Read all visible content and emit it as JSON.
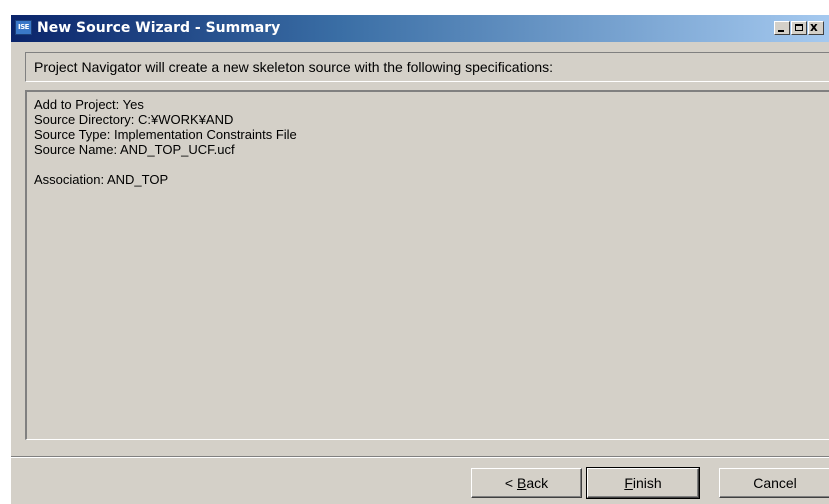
{
  "window": {
    "title": "New Source Wizard - Summary",
    "app_icon_text": "ISE",
    "controls": {
      "minimize": "_",
      "maximize": "□",
      "close": "x"
    }
  },
  "header": {
    "text": "Project Navigator will create a new skeleton source with the following specifications:"
  },
  "summary": {
    "add_to_project": "Add to Project: Yes",
    "source_directory": "Source Directory: C:¥WORK¥AND",
    "source_type": "Source Type: Implementation Constraints File",
    "source_name": "Source Name: AND_TOP_UCF.ucf",
    "association": "Association: AND_TOP"
  },
  "buttons": {
    "back": {
      "prefix": "< ",
      "mnemonic": "B",
      "rest": "ack"
    },
    "finish": {
      "prefix": "",
      "mnemonic": "F",
      "rest": "inish"
    },
    "cancel": {
      "label": "Cancel"
    }
  }
}
